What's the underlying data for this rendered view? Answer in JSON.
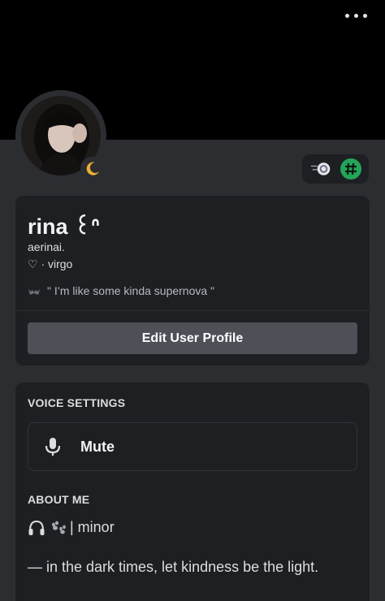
{
  "profile": {
    "display_name": "rina ꒰ᐢ",
    "username": "aerinai.",
    "pronouns": "♡ · virgo",
    "custom_status": "\" I’m like some kinda supernova \"",
    "status_emoji": "bat-emoji",
    "presence": "idle",
    "avatar_icon": "user-avatar"
  },
  "badges": [
    {
      "icon": "nitro-badge-icon",
      "color": "#5865f2"
    },
    {
      "icon": "hashtag-badge-icon",
      "color": "#23a55a"
    }
  ],
  "actions": {
    "edit_label": "Edit User Profile"
  },
  "voice_settings": {
    "heading": "VOICE SETTINGS",
    "mute_label": "Mute"
  },
  "about": {
    "heading": "ABOUT ME",
    "line1": "| minor",
    "line1_icons": [
      "headphones-icon",
      "paw-prints-icon"
    ],
    "line2": "— in the dark times, let kindness be the light."
  },
  "colors": {
    "banner": "#000000",
    "background": "#2b2d31",
    "card": "#1e1f22",
    "button": "#4e5058",
    "idle_moon": "#f0b232"
  }
}
